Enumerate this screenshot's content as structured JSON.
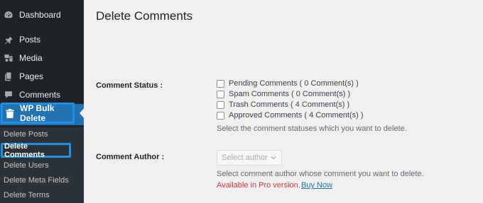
{
  "sidebar": {
    "items": [
      {
        "label": "Dashboard",
        "icon": "dashboard-icon"
      },
      {
        "label": "Posts",
        "icon": "pin-icon"
      },
      {
        "label": "Media",
        "icon": "media-icon"
      },
      {
        "label": "Pages",
        "icon": "pages-icon"
      },
      {
        "label": "Comments",
        "icon": "comment-icon"
      }
    ],
    "active": {
      "label": "WP Bulk Delete",
      "icon": "trash-icon"
    },
    "submenu": [
      {
        "label": "Delete Posts"
      },
      {
        "label": "Delete Comments",
        "current": true
      },
      {
        "label": "Delete Users"
      },
      {
        "label": "Delete Meta Fields"
      },
      {
        "label": "Delete Terms"
      }
    ]
  },
  "main": {
    "title": "Delete Comments",
    "comment_status": {
      "label": "Comment Status :",
      "options": [
        "Pending Comments ( 0 Comment(s) )",
        "Spam Comments ( 0 Comment(s) )",
        "Trash Comments ( 4 Comment(s) )",
        "Approved Comments ( 4 Comment(s) )"
      ],
      "description": "Select the comment statuses which you want to delete."
    },
    "comment_author": {
      "label": "Comment Author :",
      "select_placeholder": "Select author",
      "description": "Select comment author whose comment you want to delete.",
      "pro_notice": "Available in Pro version.",
      "buy_link": "Buy Now"
    }
  },
  "colors": {
    "sidebar_bg": "#1d2327",
    "accent": "#2271b1",
    "highlight": "#1e90e8",
    "pro_red": "#d63638"
  }
}
